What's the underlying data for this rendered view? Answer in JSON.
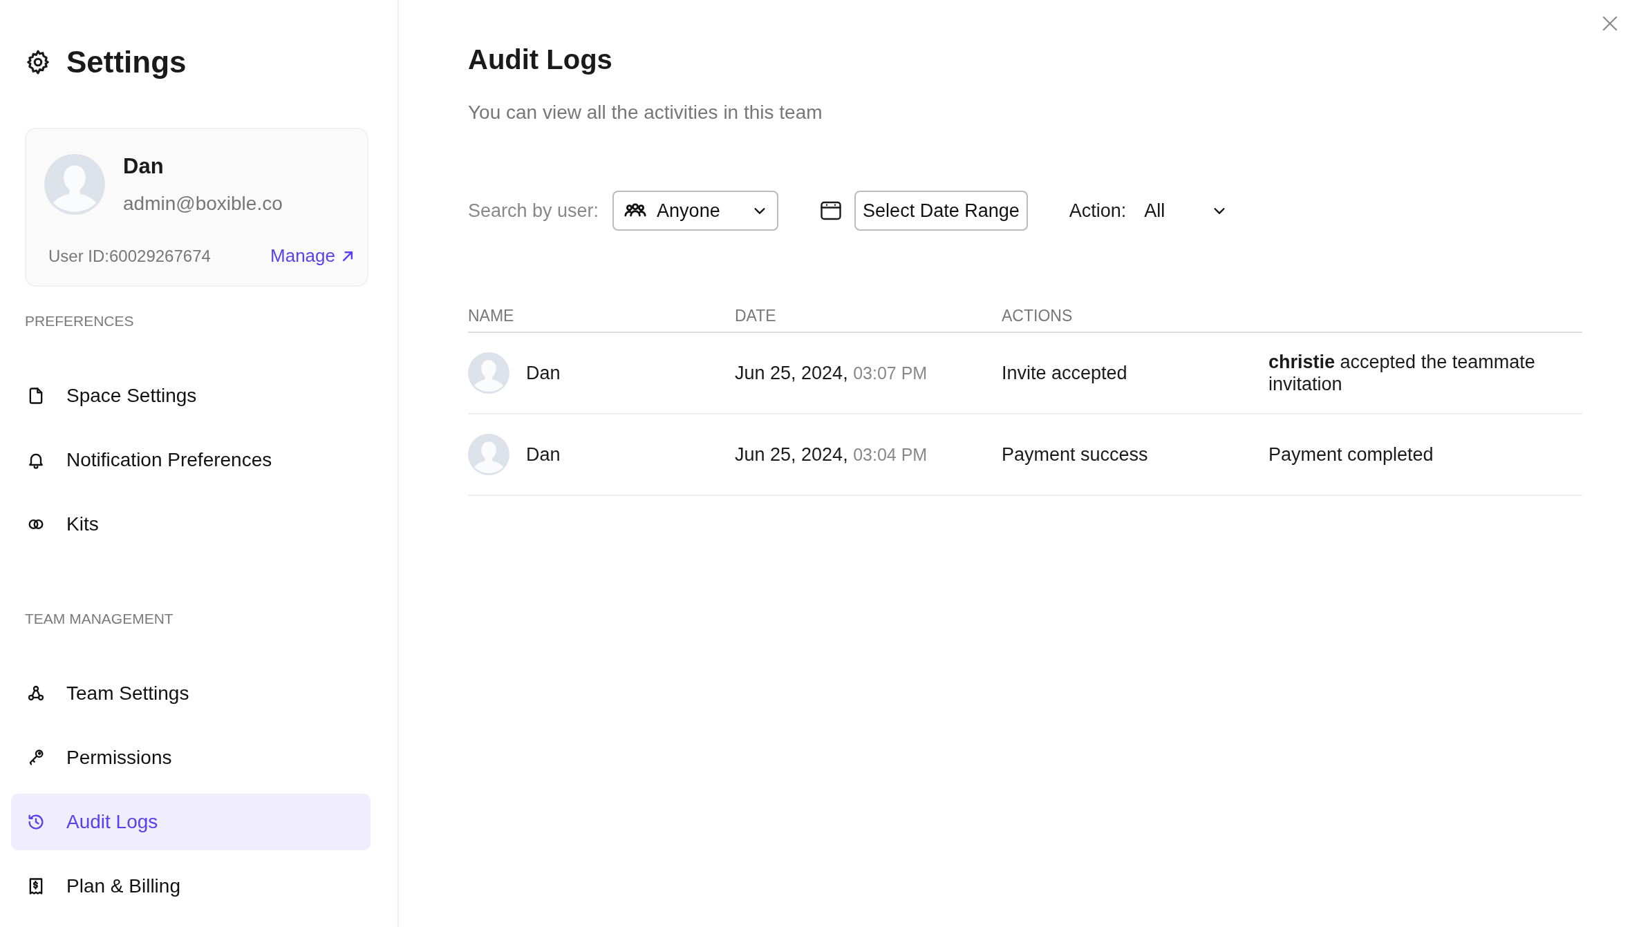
{
  "sidebar": {
    "title": "Settings",
    "profile": {
      "name": "Dan",
      "email": "admin@boxible.co",
      "user_id": "User ID:60029267674",
      "manage_link": "Manage"
    },
    "sections": [
      {
        "heading": "PREFERENCES",
        "items": [
          {
            "label": "Space Settings",
            "selected": false
          },
          {
            "label": "Notification Preferences",
            "selected": false
          },
          {
            "label": "Kits",
            "selected": false
          }
        ]
      },
      {
        "heading": "TEAM MANAGEMENT",
        "items": [
          {
            "label": "Team Settings",
            "selected": false
          },
          {
            "label": "Permissions",
            "selected": false
          },
          {
            "label": "Audit Logs",
            "selected": true
          },
          {
            "label": "Plan & Billing",
            "selected": false
          }
        ]
      }
    ]
  },
  "main": {
    "title": "Audit Logs",
    "subtitle": "You can view all the activities in this team",
    "filters": {
      "user_label": "Search by user:",
      "user_value": "Anyone",
      "date_button": "Select Date Range",
      "action_label": "Action:",
      "action_value": "All"
    },
    "table": {
      "columns": [
        "NAME",
        "DATE",
        "ACTIONS"
      ],
      "rows": [
        {
          "name": "Dan",
          "date": "Jun 25, 2024,",
          "time": "03:07 PM",
          "action": "Invite accepted",
          "detail": "**christie** accepted the teammate invitation"
        },
        {
          "name": "Dan",
          "date": "Jun 25, 2024,",
          "time": "03:04 PM",
          "action": "Payment success",
          "detail": "Payment completed"
        }
      ]
    }
  }
}
